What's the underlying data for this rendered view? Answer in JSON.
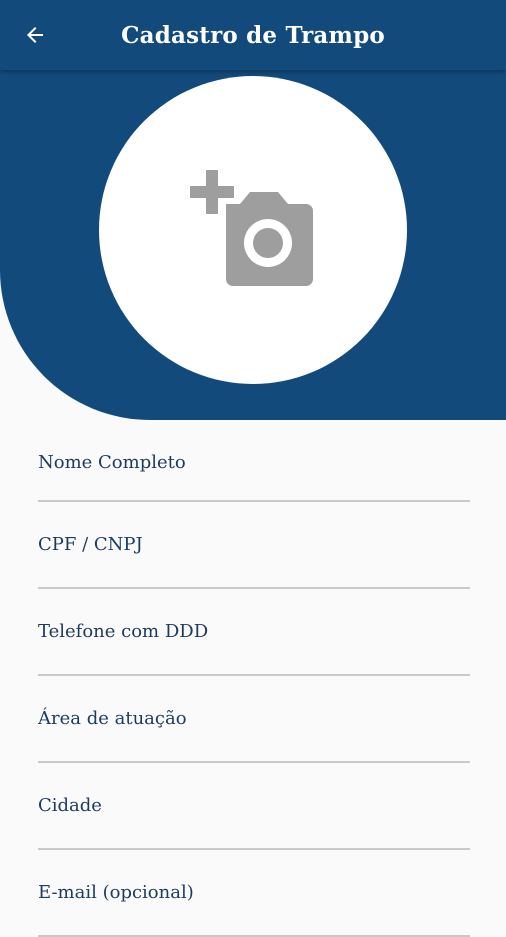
{
  "app_bar": {
    "title": "Cadastro de Trampo",
    "back_icon": "arrow-left-icon"
  },
  "photo": {
    "icon": "add-a-photo-icon"
  },
  "form": {
    "fields": [
      {
        "label": "Nome Completo"
      },
      {
        "label": "CPF / CNPJ"
      },
      {
        "label": "Telefone com DDD"
      },
      {
        "label": "Área de atuação"
      },
      {
        "label": "Cidade"
      },
      {
        "label": "E-mail (opcional)"
      }
    ]
  },
  "colors": {
    "primary": "#134a7c",
    "background": "#fafafa",
    "icon_gray": "#9e9e9e",
    "divider": "#c9c9c9"
  }
}
